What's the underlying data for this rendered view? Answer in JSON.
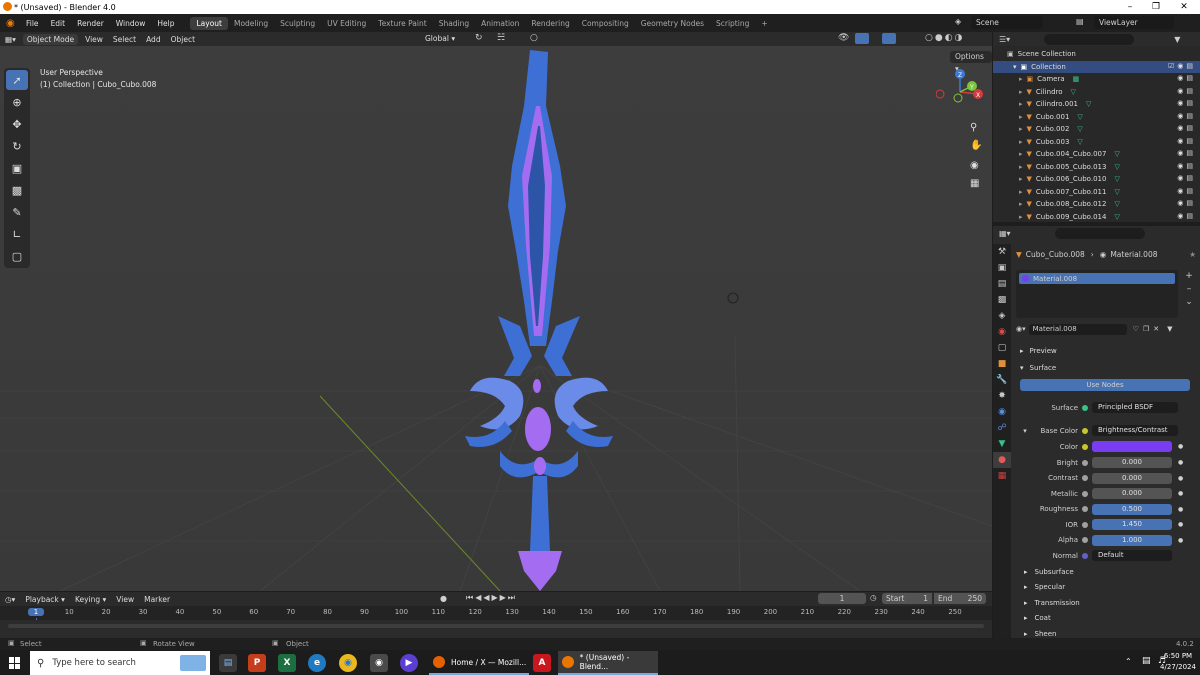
{
  "window": {
    "title": "* (Unsaved) - Blender 4.0"
  },
  "menu": [
    "File",
    "Edit",
    "Render",
    "Window",
    "Help"
  ],
  "workspaces": [
    "Layout",
    "Modeling",
    "Sculpting",
    "UV Editing",
    "Texture Paint",
    "Shading",
    "Animation",
    "Rendering",
    "Compositing",
    "Geometry Nodes",
    "Scripting"
  ],
  "active_workspace": "Layout",
  "scene": {
    "name": "Scene",
    "view_layer": "ViewLayer"
  },
  "viewport": {
    "mode": "Object Mode",
    "menus": [
      "View",
      "Select",
      "Add",
      "Object"
    ],
    "orientation": "Global",
    "options_label": "Options",
    "perspective": "User Perspective",
    "collection_info": "(1) Collection | Cubo_Cubo.008",
    "axes": {
      "x": "X",
      "y": "Y",
      "z": "Z"
    }
  },
  "outliner": {
    "root": "Scene Collection",
    "collection": "Collection",
    "items": [
      "Camera",
      "Cilindro",
      "Cilindro.001",
      "Cubo.001",
      "Cubo.002",
      "Cubo.003",
      "Cubo.004_Cubo.007",
      "Cubo.005_Cubo.013",
      "Cubo.006_Cubo.010",
      "Cubo.007_Cubo.011",
      "Cubo.008_Cubo.012",
      "Cubo.009_Cubo.014"
    ]
  },
  "properties": {
    "object": "Cubo_Cubo.008",
    "material": "Material.008",
    "slot": "Material.008",
    "material_field": "Material.008",
    "preview_label": "Preview",
    "surface_label": "Surface",
    "use_nodes": "Use Nodes",
    "surface_row": {
      "label": "Surface",
      "value": "Principled BSDF"
    },
    "base_color_row": {
      "label": "Base Color",
      "value": "Brightness/Contrast"
    },
    "color_label": "Color",
    "color_value": "#7a3cf0",
    "params": [
      {
        "label": "Bright",
        "value": "0.000"
      },
      {
        "label": "Contrast",
        "value": "0.000"
      },
      {
        "label": "Metallic",
        "value": "0.000"
      },
      {
        "label": "Roughness",
        "value": "0.500"
      },
      {
        "label": "IOR",
        "value": "1.450"
      },
      {
        "label": "Alpha",
        "value": "1.000"
      }
    ],
    "normal": {
      "label": "Normal",
      "value": "Default"
    },
    "sections": [
      "Subsurface",
      "Specular",
      "Transmission",
      "Coat",
      "Sheen"
    ]
  },
  "timeline": {
    "menus": [
      "Playback",
      "Keying",
      "View",
      "Marker"
    ],
    "current_frame": "1",
    "start_label": "Start",
    "start": "1",
    "end_label": "End",
    "end": "250",
    "ticks": [
      "1",
      "10",
      "20",
      "30",
      "40",
      "50",
      "60",
      "70",
      "80",
      "90",
      "100",
      "110",
      "120",
      "130",
      "140",
      "150",
      "160",
      "170",
      "180",
      "190",
      "200",
      "210",
      "220",
      "230",
      "240",
      "250"
    ]
  },
  "statusbar": {
    "select": "Select",
    "rotate": "Rotate View",
    "object": "Object",
    "version": "4.0.2"
  },
  "taskbar": {
    "search_placeholder": "Type here to search",
    "firefox_task": "Home / X — Mozill...",
    "blender_task": "* (Unsaved) - Blend...",
    "time": "6:50 PM",
    "date": "4/27/2024"
  }
}
